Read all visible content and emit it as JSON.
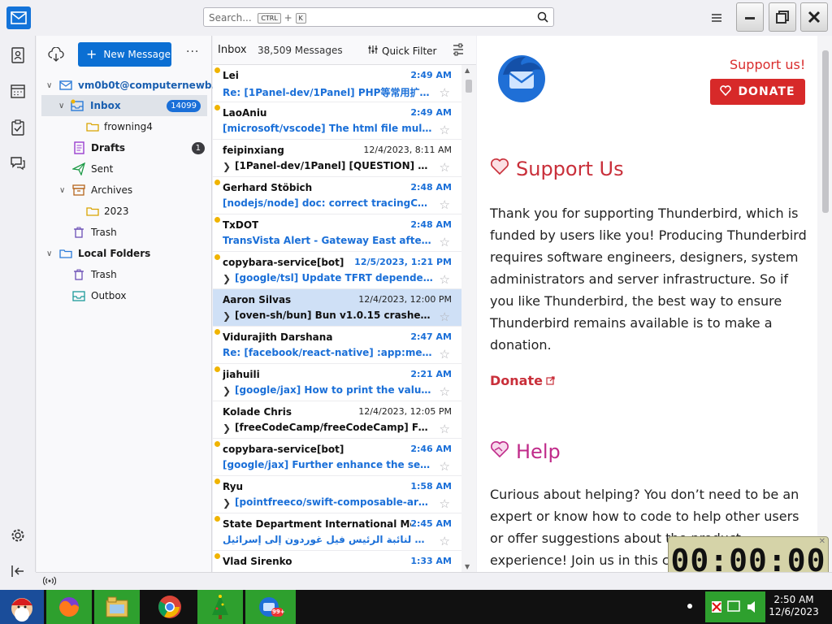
{
  "search": {
    "placeholder": "Search...",
    "key1": "CTRL",
    "plus": "+",
    "key2": "K"
  },
  "folder_pane": {
    "new_message": "New Message",
    "more": "···",
    "account": "vm0b0t@computernewb...",
    "folders": [
      {
        "label": "Inbox",
        "badge": "14099"
      },
      {
        "label": "frowning4"
      },
      {
        "label": "Drafts",
        "badge": "1"
      },
      {
        "label": "Sent"
      },
      {
        "label": "Archives"
      },
      {
        "label": "2023"
      },
      {
        "label": "Trash"
      }
    ],
    "local_folders": "Local Folders",
    "local": [
      {
        "label": "Trash"
      },
      {
        "label": "Outbox"
      }
    ]
  },
  "list": {
    "title": "Inbox",
    "count": "38,509 Messages",
    "quick_filter": "Quick Filter",
    "messages": [
      {
        "sender": "Lei",
        "time": "2:49 AM",
        "subject": "Re: [1Panel-dev/1Panel] PHP等常用扩展...",
        "unread": true,
        "thread": false
      },
      {
        "sender": "LaoAniu",
        "time": "2:49 AM",
        "subject": "[microsoft/vscode] The html file multili...",
        "unread": true,
        "thread": false
      },
      {
        "sender": "feipinxiang",
        "time": "12/4/2023, 8:11 AM",
        "subject": "[1Panel-dev/1Panel] [QUESTION] nod...",
        "unread": false,
        "thread": true
      },
      {
        "sender": "Gerhard Stöbich",
        "time": "2:48 AM",
        "subject": "[nodejs/node] doc: correct tracingChan...",
        "unread": true,
        "thread": false
      },
      {
        "sender": "TxDOT",
        "time": "2:48 AM",
        "subject": "TransVista Alert - Gateway East after Co...",
        "unread": true,
        "thread": false
      },
      {
        "sender": "copybara-service[bot]",
        "time": "12/5/2023, 1:21 PM",
        "subject": "[google/tsl] Update TFRT dependenc...",
        "unread": true,
        "thread": true
      },
      {
        "sender": "Aaron Silvas",
        "time": "12/4/2023, 12:00 PM",
        "subject": "[oven-sh/bun] Bun v1.0.15 crashes b...",
        "unread": false,
        "thread": true,
        "selected": true
      },
      {
        "sender": "Vidurajith Darshana",
        "time": "2:47 AM",
        "subject": "Re: [facebook/react-native] :app:merge...",
        "unread": true,
        "thread": false
      },
      {
        "sender": "jiahuili",
        "time": "2:21 AM",
        "subject": "[google/jax] How to print the value i...",
        "unread": true,
        "thread": true
      },
      {
        "sender": "Kolade Chris",
        "time": "12/4/2023, 12:05 PM",
        "subject": "[freeCodeCamp/freeCodeCamp] Feat/...",
        "unread": false,
        "thread": true
      },
      {
        "sender": "copybara-service[bot]",
        "time": "2:46 AM",
        "subject": "[google/jax] Further enhance the seed (...",
        "unread": true,
        "thread": false
      },
      {
        "sender": "Ryu",
        "time": "1:58 AM",
        "subject": "[pointfreeco/swift-composable-archit...",
        "unread": true,
        "thread": true
      },
      {
        "sender": "State Department International Media ...",
        "time": "2:45 AM",
        "subject": "الوطني لنائبة الرئيس فيل غوردون إلى إسرائيل ...",
        "unread": true,
        "thread": false
      },
      {
        "sender": "Vlad Sirenko",
        "time": "1:33 AM",
        "subject": "",
        "unread": true,
        "thread": false
      }
    ]
  },
  "content": {
    "support_link": "Support us!",
    "donate_button": "DONATE",
    "support_title": "Support Us",
    "support_text": "Thank you for supporting Thunderbird, which is funded by users like you! Producing Thunderbird requires software engineers, designers, system administrators and server infrastructure. So if you like Thunderbird, the best way to ensure Thunderbird remains available is to make a donation.",
    "donate_link": "Donate",
    "help_title": "Help",
    "help_text": "Curious about helping? You don’t need to be an expert or know how to code to help other users or offer suggestions about the product experience! Join us in this c"
  },
  "timer": {
    "value": "00:00:00"
  },
  "taskbar": {
    "time": "2:50 AM",
    "date": "12/6/2023",
    "badge": "99+"
  },
  "colors": {
    "accent": "#0b6fd3",
    "unread": "#1a6fd8",
    "donate": "#d72929",
    "help": "#c02b8a"
  }
}
